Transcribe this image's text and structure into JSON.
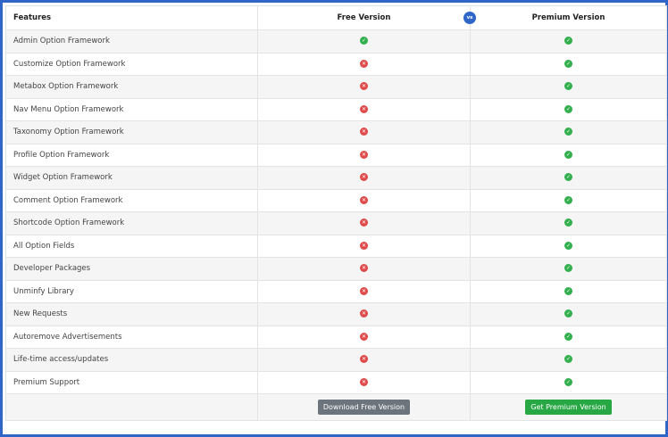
{
  "header": {
    "features": "Features",
    "free": "Free Version",
    "vs": "vs",
    "premium": "Premium Version"
  },
  "icons": {
    "yes": "check-circle-icon",
    "no": "x-circle-icon",
    "yes_color": "#33b04d",
    "no_color": "#df4a4a"
  },
  "rows": [
    {
      "feature": "Admin Option Framework",
      "free": true,
      "premium": true
    },
    {
      "feature": "Customize Option Framework",
      "free": false,
      "premium": true
    },
    {
      "feature": "Metabox Option Framework",
      "free": false,
      "premium": true
    },
    {
      "feature": "Nav Menu Option Framework",
      "free": false,
      "premium": true
    },
    {
      "feature": "Taxonomy Option Framework",
      "free": false,
      "premium": true
    },
    {
      "feature": "Profile Option Framework",
      "free": false,
      "premium": true
    },
    {
      "feature": "Widget Option Framework",
      "free": false,
      "premium": true
    },
    {
      "feature": "Comment Option Framework",
      "free": false,
      "premium": true
    },
    {
      "feature": "Shortcode Option Framework",
      "free": false,
      "premium": true
    },
    {
      "feature": "All Option Fields",
      "free": false,
      "premium": true
    },
    {
      "feature": "Developer Packages",
      "free": false,
      "premium": true
    },
    {
      "feature": "Unminfy Library",
      "free": false,
      "premium": true
    },
    {
      "feature": "New Requests",
      "free": false,
      "premium": true
    },
    {
      "feature": "Autoremove Advertisements",
      "free": false,
      "premium": true
    },
    {
      "feature": "Life-time access/updates",
      "free": false,
      "premium": true
    },
    {
      "feature": "Premium Support",
      "free": false,
      "premium": true
    }
  ],
  "footer": {
    "download_free": "Download Free Version",
    "get_premium": "Get Premium Version"
  },
  "colors": {
    "frame": "#2f66c8",
    "free_button": "#6c757d",
    "premium_button": "#28a745"
  }
}
